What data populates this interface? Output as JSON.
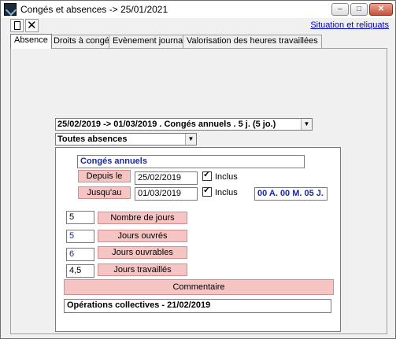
{
  "window": {
    "title": "Congés et absences -> 25/01/2021",
    "min_glyph": "–",
    "max_glyph": "□",
    "close_glyph": "✕"
  },
  "toolbar": {
    "new_icon": "new-document-icon",
    "delete_icon": "close-x-icon",
    "delete_glyph": "✕",
    "link_label": "Situation et reliquats"
  },
  "tabs": [
    {
      "label": "Absence",
      "active": true
    },
    {
      "label": "Droits à congés",
      "active": false
    },
    {
      "label": "Evènement journalier",
      "active": false
    },
    {
      "label": "Valorisation des heures travaillées",
      "active": false
    }
  ],
  "selectors": {
    "period": "25/02/2019 -> 01/03/2019 . Congés annuels . 5 j. (5 jo.)",
    "filter": "Toutes absences",
    "arrow_glyph": "▼"
  },
  "absence": {
    "type": "Congés annuels",
    "start_label": "Depuis le",
    "start_value": "25/02/2019",
    "start_inclus_label": "Inclus",
    "start_inclus_checked": true,
    "end_label": "Jusqu'au",
    "end_value": "01/03/2019",
    "end_inclus_label": "Inclus",
    "end_inclus_checked": true,
    "check_glyph": "✓",
    "duration": "00 A. 00 M. 05 J."
  },
  "counts": [
    {
      "value": "5",
      "label": "Nombre de jours",
      "value_color": "black"
    },
    {
      "value": "5",
      "label": "Jours ouvrés",
      "value_color": "blue"
    },
    {
      "value": "6",
      "label": "Jours ouvrables",
      "value_color": "blue"
    },
    {
      "value": "4,5",
      "label": "Jours travaillés",
      "value_color": "black"
    }
  ],
  "comment": {
    "button_label": "Commentaire",
    "text": "Opérations collectives - 21/02/2019"
  }
}
